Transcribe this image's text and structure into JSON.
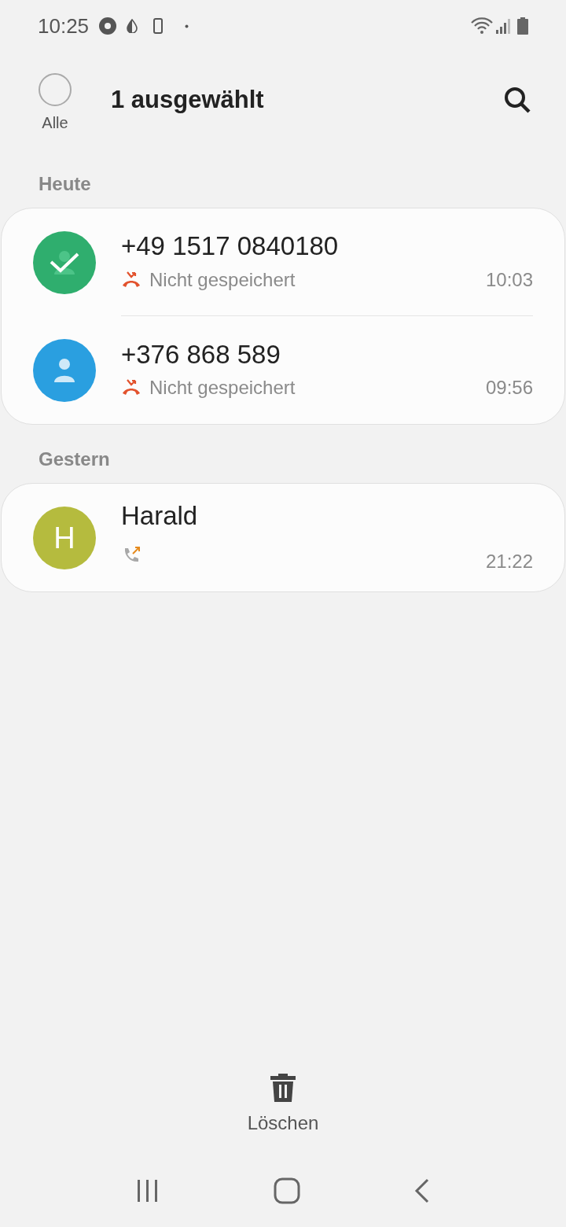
{
  "status_bar": {
    "time": "10:25"
  },
  "header": {
    "select_all": {
      "label": "Alle",
      "checked": false
    },
    "title": "1 ausgewählt"
  },
  "groups": [
    {
      "label": "Heute",
      "calls": [
        {
          "name": "+49 1517 0840180",
          "avatar": {
            "kind": "person",
            "color": "#2fae6e"
          },
          "selected": true,
          "kind": "missed",
          "subtitle": "Nicht gespeichert",
          "time": "10:03"
        },
        {
          "name": "+376 868 589",
          "avatar": {
            "kind": "person",
            "color": "#2a9fe0"
          },
          "selected": false,
          "kind": "missed",
          "subtitle": "Nicht gespeichert",
          "time": "09:56"
        }
      ]
    },
    {
      "label": "Gestern",
      "calls": [
        {
          "name": "Harald",
          "avatar": {
            "kind": "initial",
            "initial": "H",
            "color": "#b5bb3e"
          },
          "selected": false,
          "kind": "outgoing",
          "time": "21:22"
        }
      ]
    }
  ],
  "bottom_action": {
    "label": "Löschen"
  }
}
